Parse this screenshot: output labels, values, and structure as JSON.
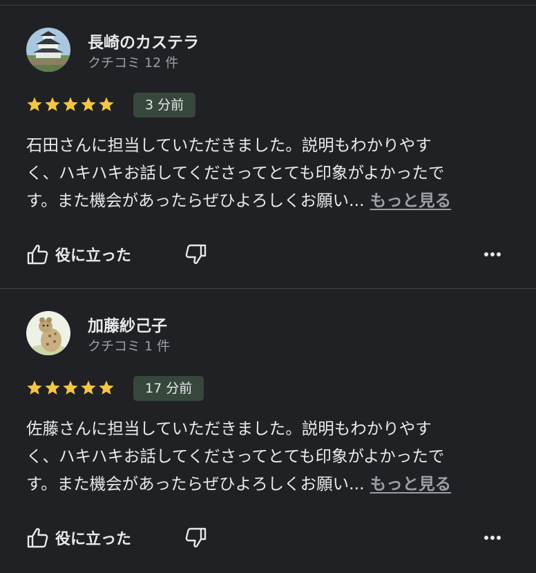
{
  "reviews": [
    {
      "author": "長崎のカステラ",
      "meta": "クチコミ 12 件",
      "rating": 5,
      "time": "3 分前",
      "text_lines": [
        "石田さんに担当していただきました。説明もわかりやす",
        "く、ハキハキお話してくださってとても印象がよかったで",
        "す。また機会があったらぜひよろしくお願い..."
      ],
      "more_label": "もっと見る",
      "helpful_label": "役に立った",
      "avatar_icon": "castle-avatar-icon"
    },
    {
      "author": "加藤紗己子",
      "meta": "クチコミ 1 件",
      "rating": 5,
      "time": "17 分前",
      "text_lines": [
        "佐藤さんに担当していただきました。説明もわかりやす",
        "く、ハキハキお話してくださってとても印象がよかったで",
        "す。また機会があったらぜひよろしくお願い..."
      ],
      "more_label": "もっと見る",
      "helpful_label": "役に立った",
      "avatar_icon": "hyena-avatar-icon"
    }
  ],
  "colors": {
    "background": "#202124",
    "star": "#f4c542",
    "badge_bg": "#37473c",
    "secondary_text": "#9aa0a6",
    "divider": "#3c4043"
  },
  "icons": {
    "like": "thumbs-up-icon",
    "dislike": "thumbs-down-icon",
    "menu": "more-horizontal-icon",
    "star": "star-icon"
  }
}
